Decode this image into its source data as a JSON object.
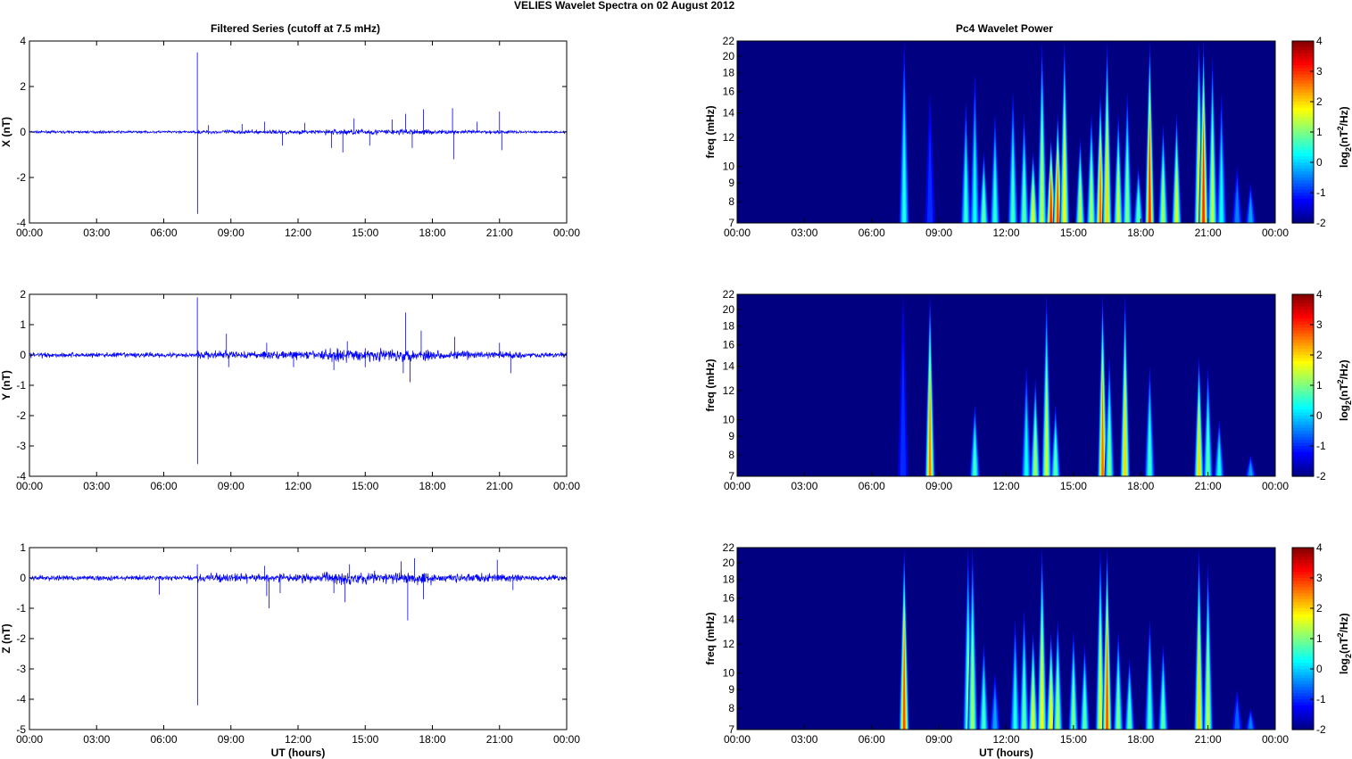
{
  "figure_title": "VELIES Wavelet Spectra on 02 August    2012",
  "chart_data": [
    {
      "type": "line",
      "title": "Filtered Series (cutoff at 7.5 mHz)",
      "panels": [
        {
          "ylabel": "X (nT)",
          "ylim": [
            -4,
            4
          ],
          "yticks": [
            "4",
            "2",
            "0",
            "-2",
            "-4"
          ],
          "noise": 0.05,
          "spikes": [
            [
              7.5,
              3.5
            ],
            [
              7.51,
              -3.6
            ],
            [
              8.0,
              0.3
            ],
            [
              9.5,
              0.35
            ],
            [
              10.5,
              0.45
            ],
            [
              11.3,
              -0.6
            ],
            [
              12.3,
              0.4
            ],
            [
              13.5,
              -0.7
            ],
            [
              14.0,
              -0.9
            ],
            [
              14.5,
              0.6
            ],
            [
              15.2,
              -0.6
            ],
            [
              16.2,
              0.55
            ],
            [
              16.8,
              0.8
            ],
            [
              17.1,
              -0.7
            ],
            [
              17.6,
              1.0
            ],
            [
              18.9,
              1.05
            ],
            [
              18.95,
              -1.2
            ],
            [
              20.0,
              0.45
            ],
            [
              21.0,
              0.9
            ],
            [
              21.1,
              -0.8
            ]
          ]
        },
        {
          "ylabel": "Y (nT)",
          "ylim": [
            -4,
            2
          ],
          "yticks": [
            "2",
            "1",
            "0",
            "-1",
            "-2",
            "-3",
            "-4"
          ],
          "noise": 0.08,
          "spikes": [
            [
              7.5,
              1.9
            ],
            [
              7.51,
              -3.6
            ],
            [
              8.8,
              0.7
            ],
            [
              8.9,
              -0.4
            ],
            [
              10.6,
              0.4
            ],
            [
              11.8,
              -0.4
            ],
            [
              13.6,
              -0.5
            ],
            [
              14.2,
              0.45
            ],
            [
              15.0,
              -0.4
            ],
            [
              16.7,
              -0.6
            ],
            [
              16.8,
              1.4
            ],
            [
              17.0,
              -0.9
            ],
            [
              17.5,
              0.8
            ],
            [
              19.0,
              0.6
            ],
            [
              21.0,
              0.4
            ],
            [
              21.5,
              -0.6
            ]
          ]
        },
        {
          "ylabel": "Z (nT)",
          "xlabel": "UT (hours)",
          "ylim": [
            -5,
            1
          ],
          "yticks": [
            "1",
            "0",
            "-1",
            "-2",
            "-3",
            "-4",
            "-5"
          ],
          "noise": 0.08,
          "spikes": [
            [
              5.8,
              -0.55
            ],
            [
              7.5,
              0.45
            ],
            [
              7.51,
              -4.2
            ],
            [
              10.5,
              0.4
            ],
            [
              10.6,
              -0.6
            ],
            [
              10.7,
              -1.0
            ],
            [
              11.2,
              -0.5
            ],
            [
              13.6,
              -0.5
            ],
            [
              14.1,
              -0.8
            ],
            [
              14.3,
              0.45
            ],
            [
              16.6,
              0.55
            ],
            [
              16.9,
              -1.4
            ],
            [
              17.2,
              0.65
            ],
            [
              17.6,
              -0.7
            ],
            [
              20.9,
              0.6
            ],
            [
              21.6,
              -0.4
            ]
          ]
        }
      ],
      "xticks": [
        "00:00",
        "03:00",
        "06:00",
        "09:00",
        "12:00",
        "15:00",
        "18:00",
        "21:00",
        "00:00"
      ],
      "xlim_hours": [
        0,
        24
      ]
    },
    {
      "type": "heatmap",
      "title": "Pc4 Wavelet Power",
      "ylabel": "freq (mHz)",
      "ylim": [
        7,
        22
      ],
      "yscale": "log",
      "yticks": [
        "22",
        "20",
        "18",
        "16",
        "14",
        "12",
        "10",
        "9",
        "8",
        "7"
      ],
      "colorbar": {
        "label": "log2(nT^2/Hz)",
        "label_main": "log",
        "label_sub": "2",
        "label_rest1": "(nT",
        "label_sup": "2",
        "label_rest2": "/Hz)",
        "range": [
          -2,
          4
        ],
        "ticks": [
          "4",
          "3",
          "2",
          "1",
          "0",
          "-1",
          "-2"
        ]
      },
      "panels": [
        {
          "bursts": [
            [
              7.45,
              0.4,
              22
            ],
            [
              8.6,
              -1,
              16
            ],
            [
              10.2,
              0.5,
              15
            ],
            [
              10.6,
              0.3,
              18
            ],
            [
              11.0,
              0.8,
              11
            ],
            [
              11.5,
              0.5,
              14
            ],
            [
              12.3,
              0.6,
              16
            ],
            [
              12.8,
              0.8,
              14
            ],
            [
              13.2,
              1.6,
              11
            ],
            [
              13.6,
              1.4,
              22
            ],
            [
              14.0,
              3.0,
              12
            ],
            [
              14.3,
              2.8,
              14
            ],
            [
              14.6,
              1.8,
              22
            ],
            [
              15.3,
              1.4,
              12
            ],
            [
              15.8,
              1.2,
              14
            ],
            [
              16.2,
              2.6,
              16
            ],
            [
              16.5,
              2.0,
              22
            ],
            [
              17.0,
              1.5,
              14
            ],
            [
              17.4,
              1.0,
              16
            ],
            [
              17.9,
              0.8,
              10
            ],
            [
              18.4,
              3.0,
              22
            ],
            [
              19.0,
              1.2,
              13
            ],
            [
              19.6,
              1.6,
              14
            ],
            [
              20.6,
              2.0,
              22
            ],
            [
              20.8,
              3.0,
              22
            ],
            [
              21.2,
              1.4,
              20
            ],
            [
              21.6,
              0.3,
              16
            ],
            [
              22.3,
              -0.5,
              10
            ],
            [
              22.9,
              -0.3,
              9
            ]
          ]
        },
        {
          "bursts": [
            [
              7.4,
              -1,
              22
            ],
            [
              8.6,
              2.5,
              22
            ],
            [
              10.6,
              0.6,
              11
            ],
            [
              12.9,
              0.3,
              14
            ],
            [
              13.3,
              1.2,
              13
            ],
            [
              13.8,
              1.5,
              22
            ],
            [
              14.2,
              0.8,
              11
            ],
            [
              16.3,
              2.6,
              22
            ],
            [
              16.6,
              1.0,
              15
            ],
            [
              17.3,
              2.0,
              22
            ],
            [
              18.4,
              0.6,
              14
            ],
            [
              20.6,
              2.0,
              15
            ],
            [
              21.0,
              0.8,
              14
            ],
            [
              21.5,
              0.4,
              10
            ],
            [
              22.9,
              -0.3,
              8
            ]
          ]
        },
        {
          "bursts": [
            [
              7.45,
              2.8,
              22
            ],
            [
              10.3,
              1.0,
              22
            ],
            [
              10.5,
              1.2,
              22
            ],
            [
              11.0,
              0.6,
              12
            ],
            [
              11.5,
              -0.3,
              10
            ],
            [
              12.4,
              0.4,
              14
            ],
            [
              12.8,
              0.8,
              15
            ],
            [
              13.2,
              1.6,
              13
            ],
            [
              13.6,
              1.8,
              22
            ],
            [
              14.0,
              1.8,
              13
            ],
            [
              14.3,
              1.2,
              14
            ],
            [
              15.0,
              1.0,
              13
            ],
            [
              15.5,
              0.8,
              12
            ],
            [
              16.2,
              1.6,
              22
            ],
            [
              16.5,
              2.8,
              22
            ],
            [
              17.0,
              1.0,
              13
            ],
            [
              17.5,
              0.8,
              11
            ],
            [
              18.4,
              0.6,
              14
            ],
            [
              19.0,
              0.8,
              12
            ],
            [
              20.6,
              2.0,
              22
            ],
            [
              21.0,
              1.4,
              20
            ],
            [
              22.3,
              -0.7,
              9
            ],
            [
              22.9,
              -0.5,
              8
            ]
          ]
        }
      ],
      "xticks": [
        "00:00",
        "03:00",
        "06:00",
        "09:00",
        "12:00",
        "15:00",
        "18:00",
        "21:00",
        "00:00"
      ],
      "xlabel": "UT (hours)"
    }
  ]
}
